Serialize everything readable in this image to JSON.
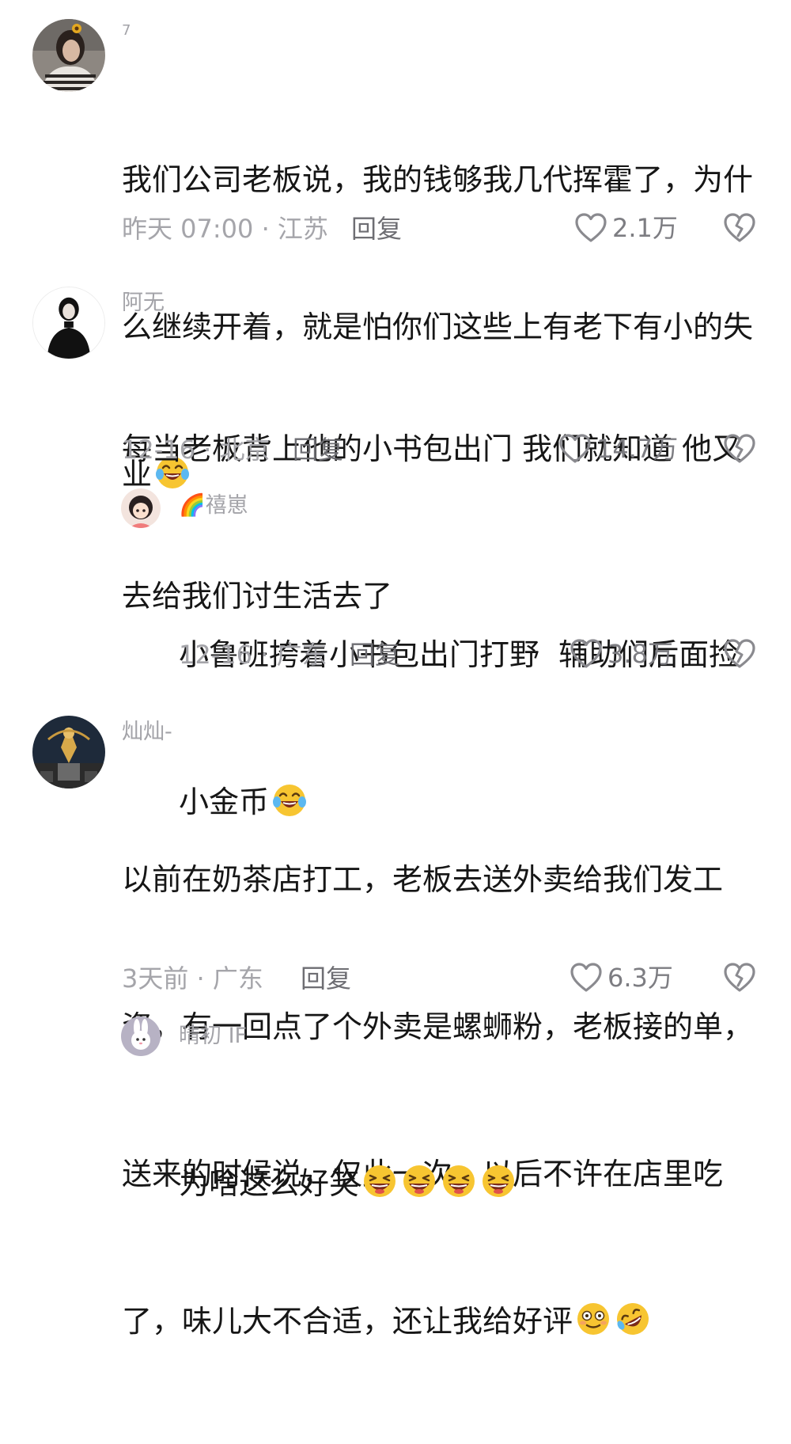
{
  "comments": [
    {
      "username": "7",
      "lines": [
        "我们公司老板说，我的钱够我几代挥霍了，为什",
        "么继续开着，就是怕你们这些上有老下有小的失",
        "业"
      ],
      "emojis": [
        "crying-laughing-emoji"
      ],
      "meta": "昨天 07:00 · 江苏",
      "reply_label": "回复",
      "likes": "2.1万"
    },
    {
      "username": "阿无",
      "lines": [
        "每当老板背上他的小书包出门 我们就知道 他又",
        "去给我们讨生活去了"
      ],
      "emojis": [],
      "meta": "12-16 · 北京",
      "reply_label": "回复",
      "likes": "14.7万"
    },
    {
      "username": "🌈禧崽",
      "lines": [
        "小鲁班挎着小书包出门打野  辅助们后面捡",
        "小金币"
      ],
      "emojis": [
        "crying-laughing-emoji"
      ],
      "meta": "12-16 · 广东",
      "reply_label": "回复",
      "likes": "3.8万"
    },
    {
      "username": "灿灿-",
      "lines": [
        "以前在奶茶店打工，老板去送外卖给我们发工",
        "资，有一回点了个外卖是螺蛳粉，老板接的单，",
        "送来的时候说，仅此一次，以后不许在店里吃",
        "了，味儿大不合适，还让我给好评"
      ],
      "emojis": [
        "flushed-smile-emoji",
        "rofl-emoji"
      ],
      "meta": "3天前 · 广东",
      "reply_label": "回复",
      "likes": "6.3万"
    },
    {
      "username": "晴初 IF",
      "lines": [
        "为啥这么好笑"
      ],
      "emojis": [
        "laughing-emoji",
        "laughing-emoji",
        "laughing-emoji",
        "laughing-emoji"
      ]
    }
  ],
  "icons": {
    "like": "heart-outline-icon",
    "dislike": "broken-heart-icon"
  },
  "colors": {
    "text": "#161616",
    "secondary": "#a5a5aa",
    "reply": "#6e6e73",
    "emoji_face": "#f7c531"
  }
}
